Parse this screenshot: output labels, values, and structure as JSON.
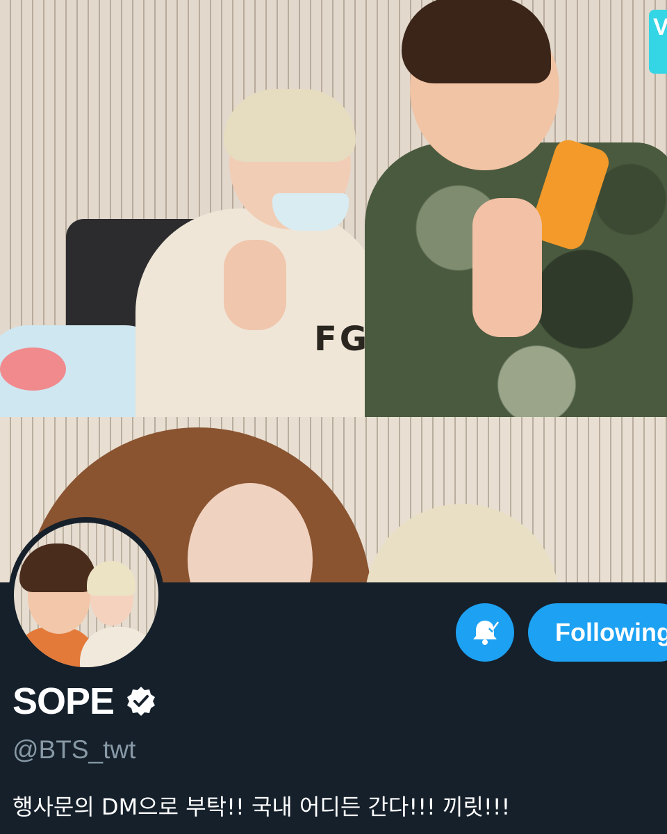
{
  "header_photo": {
    "badge_text": "VLIVE",
    "shirt_text": "FG"
  },
  "profile": {
    "display_name": "SOPE",
    "verified_icon": "verified-badge-icon",
    "handle": "@BTS_twt",
    "bio": "행사문의 DM으로 부탁!! 국내 어디든 간다!!! 끼릿!!!"
  },
  "actions": {
    "notifications_icon": "bell-check-icon",
    "follow_label": "Following"
  },
  "colors": {
    "background": "#15202b",
    "accent": "#1da1f2",
    "secondary_text": "#8899a6"
  }
}
